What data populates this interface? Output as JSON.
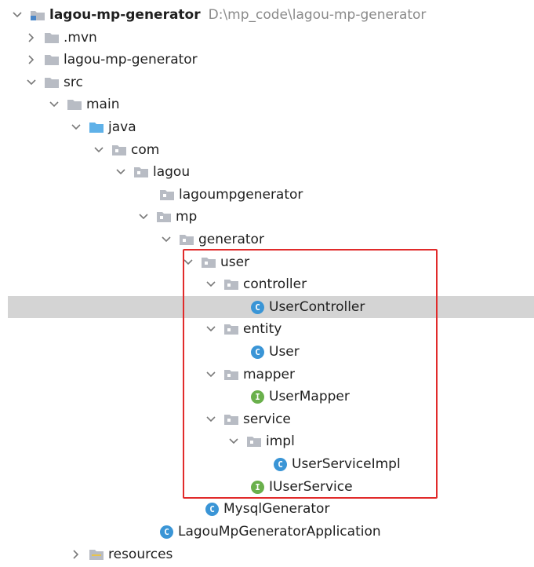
{
  "tree": {
    "root": {
      "label": "lagou-mp-generator",
      "path": "D:\\mp_code\\lagou-mp-generator"
    },
    "mvn": ".mvn",
    "module": "lagou-mp-generator",
    "src": "src",
    "main": "main",
    "java": "java",
    "com": "com",
    "lagou": "lagou",
    "lagoumpgenerator": "lagoumpgenerator",
    "mp": "mp",
    "generator": "generator",
    "user": "user",
    "controller": "controller",
    "UserController": "UserController",
    "entity": "entity",
    "User": "User",
    "mapper": "mapper",
    "UserMapper": "UserMapper",
    "service": "service",
    "impl": "impl",
    "UserServiceImpl": "UserServiceImpl",
    "IUserService": "IUserService",
    "MysqlGenerator": "MysqlGenerator",
    "LagouMpGeneratorApplication": "LagouMpGeneratorApplication",
    "resources": "resources"
  },
  "icons": {
    "class_badge": "C",
    "interface_badge": "I"
  },
  "colors": {
    "folder": "#b8bcc4",
    "source_folder": "#5fb1e8",
    "class_icon": "#3a95d6",
    "interface_icon": "#6ab04c",
    "selection": "#d4d4d4",
    "highlight_border": "#e12b2b"
  }
}
